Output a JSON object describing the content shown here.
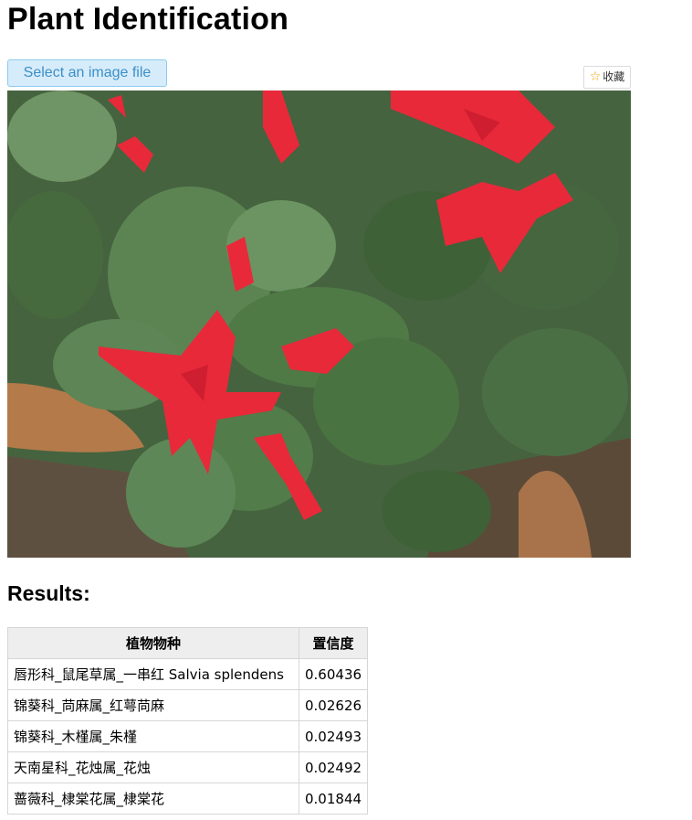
{
  "page": {
    "title": "Plant Identification"
  },
  "upload": {
    "button_label": "Select an image file"
  },
  "favorite": {
    "icon": "star-icon",
    "label": "收藏"
  },
  "image": {
    "icon": "plant-photo"
  },
  "results": {
    "heading": "Results:",
    "columns": [
      "植物物种",
      "置信度"
    ],
    "rows": [
      {
        "species": "唇形科_鼠尾草属_一串红 Salvia splendens",
        "confidence": "0.60436"
      },
      {
        "species": "锦葵科_苘麻属_红萼苘麻",
        "confidence": "0.02626"
      },
      {
        "species": "锦葵科_木槿属_朱槿",
        "confidence": "0.02493"
      },
      {
        "species": "天南星科_花烛属_花烛",
        "confidence": "0.02492"
      },
      {
        "species": "蔷薇科_棣棠花属_棣棠花",
        "confidence": "0.01844"
      }
    ]
  },
  "colors": {
    "button_bg": "#d6ecfa",
    "button_border": "#8ccbef",
    "button_text": "#3c8fc7",
    "table_header_bg": "#eeeeee",
    "table_border": "#d6d6d6"
  }
}
